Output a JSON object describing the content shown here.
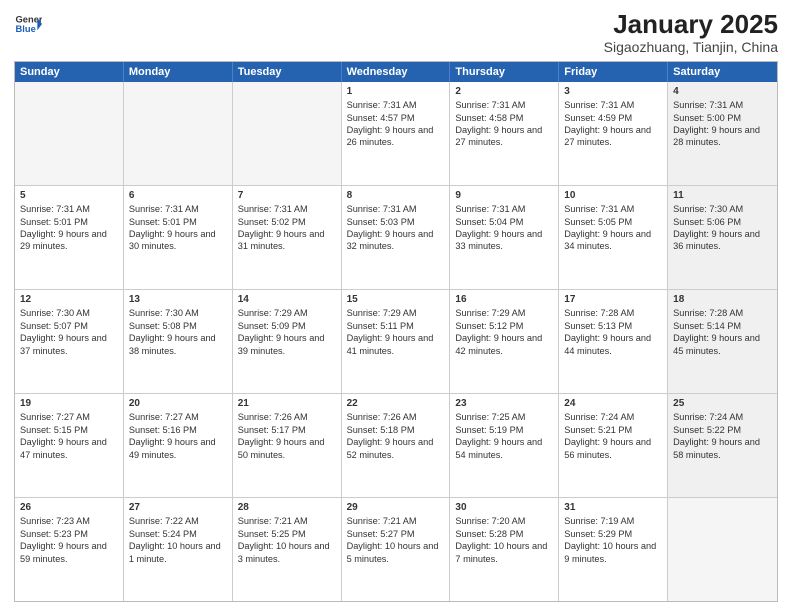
{
  "header": {
    "logo_general": "General",
    "logo_blue": "Blue",
    "title": "January 2025",
    "subtitle": "Sigaozhuang, Tianjin, China"
  },
  "days_of_week": [
    "Sunday",
    "Monday",
    "Tuesday",
    "Wednesday",
    "Thursday",
    "Friday",
    "Saturday"
  ],
  "weeks": [
    [
      {
        "day": "",
        "text": "",
        "empty": true
      },
      {
        "day": "",
        "text": "",
        "empty": true
      },
      {
        "day": "",
        "text": "",
        "empty": true
      },
      {
        "day": "1",
        "text": "Sunrise: 7:31 AM\nSunset: 4:57 PM\nDaylight: 9 hours and 26 minutes.",
        "empty": false
      },
      {
        "day": "2",
        "text": "Sunrise: 7:31 AM\nSunset: 4:58 PM\nDaylight: 9 hours and 27 minutes.",
        "empty": false
      },
      {
        "day": "3",
        "text": "Sunrise: 7:31 AM\nSunset: 4:59 PM\nDaylight: 9 hours and 27 minutes.",
        "empty": false
      },
      {
        "day": "4",
        "text": "Sunrise: 7:31 AM\nSunset: 5:00 PM\nDaylight: 9 hours and 28 minutes.",
        "empty": false,
        "shaded": true
      }
    ],
    [
      {
        "day": "5",
        "text": "Sunrise: 7:31 AM\nSunset: 5:01 PM\nDaylight: 9 hours and 29 minutes.",
        "empty": false
      },
      {
        "day": "6",
        "text": "Sunrise: 7:31 AM\nSunset: 5:01 PM\nDaylight: 9 hours and 30 minutes.",
        "empty": false
      },
      {
        "day": "7",
        "text": "Sunrise: 7:31 AM\nSunset: 5:02 PM\nDaylight: 9 hours and 31 minutes.",
        "empty": false
      },
      {
        "day": "8",
        "text": "Sunrise: 7:31 AM\nSunset: 5:03 PM\nDaylight: 9 hours and 32 minutes.",
        "empty": false
      },
      {
        "day": "9",
        "text": "Sunrise: 7:31 AM\nSunset: 5:04 PM\nDaylight: 9 hours and 33 minutes.",
        "empty": false
      },
      {
        "day": "10",
        "text": "Sunrise: 7:31 AM\nSunset: 5:05 PM\nDaylight: 9 hours and 34 minutes.",
        "empty": false
      },
      {
        "day": "11",
        "text": "Sunrise: 7:30 AM\nSunset: 5:06 PM\nDaylight: 9 hours and 36 minutes.",
        "empty": false,
        "shaded": true
      }
    ],
    [
      {
        "day": "12",
        "text": "Sunrise: 7:30 AM\nSunset: 5:07 PM\nDaylight: 9 hours and 37 minutes.",
        "empty": false
      },
      {
        "day": "13",
        "text": "Sunrise: 7:30 AM\nSunset: 5:08 PM\nDaylight: 9 hours and 38 minutes.",
        "empty": false
      },
      {
        "day": "14",
        "text": "Sunrise: 7:29 AM\nSunset: 5:09 PM\nDaylight: 9 hours and 39 minutes.",
        "empty": false
      },
      {
        "day": "15",
        "text": "Sunrise: 7:29 AM\nSunset: 5:11 PM\nDaylight: 9 hours and 41 minutes.",
        "empty": false
      },
      {
        "day": "16",
        "text": "Sunrise: 7:29 AM\nSunset: 5:12 PM\nDaylight: 9 hours and 42 minutes.",
        "empty": false
      },
      {
        "day": "17",
        "text": "Sunrise: 7:28 AM\nSunset: 5:13 PM\nDaylight: 9 hours and 44 minutes.",
        "empty": false
      },
      {
        "day": "18",
        "text": "Sunrise: 7:28 AM\nSunset: 5:14 PM\nDaylight: 9 hours and 45 minutes.",
        "empty": false,
        "shaded": true
      }
    ],
    [
      {
        "day": "19",
        "text": "Sunrise: 7:27 AM\nSunset: 5:15 PM\nDaylight: 9 hours and 47 minutes.",
        "empty": false
      },
      {
        "day": "20",
        "text": "Sunrise: 7:27 AM\nSunset: 5:16 PM\nDaylight: 9 hours and 49 minutes.",
        "empty": false
      },
      {
        "day": "21",
        "text": "Sunrise: 7:26 AM\nSunset: 5:17 PM\nDaylight: 9 hours and 50 minutes.",
        "empty": false
      },
      {
        "day": "22",
        "text": "Sunrise: 7:26 AM\nSunset: 5:18 PM\nDaylight: 9 hours and 52 minutes.",
        "empty": false
      },
      {
        "day": "23",
        "text": "Sunrise: 7:25 AM\nSunset: 5:19 PM\nDaylight: 9 hours and 54 minutes.",
        "empty": false
      },
      {
        "day": "24",
        "text": "Sunrise: 7:24 AM\nSunset: 5:21 PM\nDaylight: 9 hours and 56 minutes.",
        "empty": false
      },
      {
        "day": "25",
        "text": "Sunrise: 7:24 AM\nSunset: 5:22 PM\nDaylight: 9 hours and 58 minutes.",
        "empty": false,
        "shaded": true
      }
    ],
    [
      {
        "day": "26",
        "text": "Sunrise: 7:23 AM\nSunset: 5:23 PM\nDaylight: 9 hours and 59 minutes.",
        "empty": false
      },
      {
        "day": "27",
        "text": "Sunrise: 7:22 AM\nSunset: 5:24 PM\nDaylight: 10 hours and 1 minute.",
        "empty": false
      },
      {
        "day": "28",
        "text": "Sunrise: 7:21 AM\nSunset: 5:25 PM\nDaylight: 10 hours and 3 minutes.",
        "empty": false
      },
      {
        "day": "29",
        "text": "Sunrise: 7:21 AM\nSunset: 5:27 PM\nDaylight: 10 hours and 5 minutes.",
        "empty": false
      },
      {
        "day": "30",
        "text": "Sunrise: 7:20 AM\nSunset: 5:28 PM\nDaylight: 10 hours and 7 minutes.",
        "empty": false
      },
      {
        "day": "31",
        "text": "Sunrise: 7:19 AM\nSunset: 5:29 PM\nDaylight: 10 hours and 9 minutes.",
        "empty": false
      },
      {
        "day": "",
        "text": "",
        "empty": true,
        "shaded": true
      }
    ]
  ]
}
